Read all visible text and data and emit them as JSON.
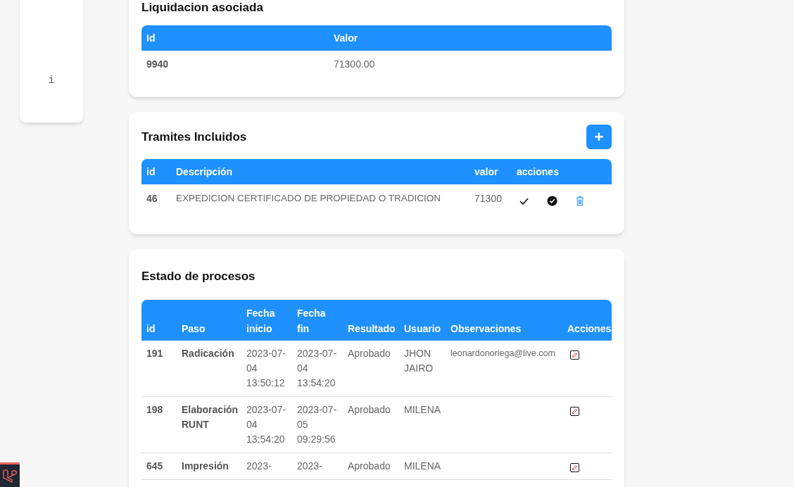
{
  "sidebar": {
    "info_label": "i"
  },
  "liquidacion": {
    "title": "Liquidacion asociada",
    "columns": [
      "Id",
      "Valor"
    ],
    "rows": [
      [
        "9940",
        "71300.00"
      ]
    ]
  },
  "tramites": {
    "title": "Tramites Incluidos",
    "add_button": "+",
    "columns": [
      "id",
      "Descripción",
      "valor",
      "acciones"
    ],
    "rows": [
      {
        "id": "46",
        "descripcion": "EXPEDICION CERTIFICADO DE PROPIEDAD O TRADICION",
        "valor": "71300"
      }
    ]
  },
  "procesos": {
    "title": "Estado de procesos",
    "columns": [
      "id",
      "Paso",
      "Fecha inicio",
      "Fecha fin",
      "Resultado",
      "Usuario",
      "Observaciones",
      "Acciones"
    ],
    "rows": [
      {
        "id": "191",
        "paso": "Radicación",
        "inicio": "2023-07-04 13:50:12",
        "fin": "2023-07-04 13:54:20",
        "resultado": "Aprobado",
        "usuario": "JHON JAIRO",
        "observaciones": "leonardonoriega@live.com"
      },
      {
        "id": "198",
        "paso": "Elaboración RUNT",
        "inicio": "2023-07-04 13:54:20",
        "fin": "2023-07-05 09:29:56",
        "resultado": "Aprobado",
        "usuario": "MILENA",
        "observaciones": ""
      },
      {
        "id": "645",
        "paso": "Impresión",
        "inicio": "2023-",
        "fin": "2023-",
        "resultado": "Aprobado",
        "usuario": "MILENA",
        "observaciones": ""
      }
    ]
  }
}
